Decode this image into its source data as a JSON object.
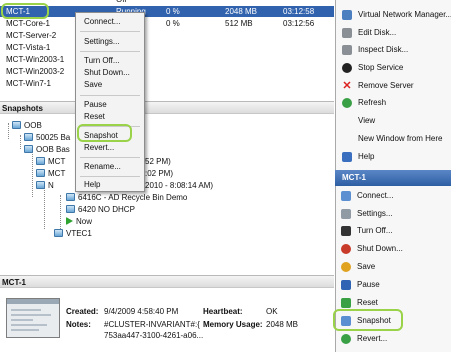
{
  "vm_list": {
    "rows": [
      {
        "name": "",
        "state": "Off",
        "cpu": "",
        "memory": "",
        "uptime": ""
      },
      {
        "name": "MCT-1",
        "state": "Running",
        "cpu": "0 %",
        "memory": "2048 MB",
        "uptime": "03:12:58"
      },
      {
        "name": "MCT-Core-1",
        "state": "",
        "cpu": "0 %",
        "memory": "512 MB",
        "uptime": "03:12:56"
      },
      {
        "name": "MCT-Server-2",
        "state": "",
        "cpu": "",
        "memory": "",
        "uptime": ""
      },
      {
        "name": "MCT-Vista-1",
        "state": "",
        "cpu": "",
        "memory": "",
        "uptime": ""
      },
      {
        "name": "MCT-Win2003-1",
        "state": "",
        "cpu": "",
        "memory": "",
        "uptime": ""
      },
      {
        "name": "MCT-Win2003-2",
        "state": "",
        "cpu": "",
        "memory": "",
        "uptime": ""
      },
      {
        "name": "MCT-Win7-1",
        "state": "",
        "cpu": "",
        "memory": "",
        "uptime": ""
      }
    ]
  },
  "context_menu": {
    "items": [
      "Connect...",
      "Settings...",
      "Turn Off...",
      "Shut Down...",
      "Save",
      "Pause",
      "Reset",
      "Snapshot",
      "Revert...",
      "Rename...",
      "Help"
    ]
  },
  "snapshots": {
    "title": "Snapshots",
    "nodes": [
      {
        "label": "OOB"
      },
      {
        "label": "50025 Ba"
      },
      {
        "label": "OOB Bas"
      },
      {
        "label": "MCT"
      },
      {
        "label": "MCT"
      },
      {
        "label": "N"
      },
      {
        "label": "6416C - AD Recycle Bin Demo"
      },
      {
        "label": "6420 NO DHCP"
      },
      {
        "label": "Now"
      },
      {
        "label": "VTEC1"
      }
    ],
    "fragments": {
      "f1": "52 PM)",
      "f2": ":02 PM)",
      "f3": "2010 - 8:08:14 AM)"
    }
  },
  "details": {
    "title": "MCT-1",
    "created_label": "Created:",
    "created_value": "9/4/2009 4:58:40 PM",
    "heartbeat_label": "Heartbeat:",
    "heartbeat_value": "OK",
    "notes_label": "Notes:",
    "notes_value_1": "#CLUSTER-INVARIANT#:{",
    "notes_value_2": "753aa447-3100-4261-a06...",
    "memory_label": "Memory Usage:",
    "memory_value": "2048 MB"
  },
  "actions": {
    "top_items": [
      "Virtual Network Manager...",
      "Edit Disk...",
      "Inspect Disk...",
      "Stop Service",
      "Remove Server",
      "Refresh",
      "View",
      "New Window from Here",
      "Help"
    ],
    "section_title": "MCT-1",
    "vm_items": [
      "Connect...",
      "Settings...",
      "Turn Off...",
      "Shut Down...",
      "Save",
      "Pause",
      "Reset",
      "Snapshot",
      "Revert..."
    ],
    "accent_color": "#2e5fa3",
    "highlight_color": "#9ad24a"
  }
}
